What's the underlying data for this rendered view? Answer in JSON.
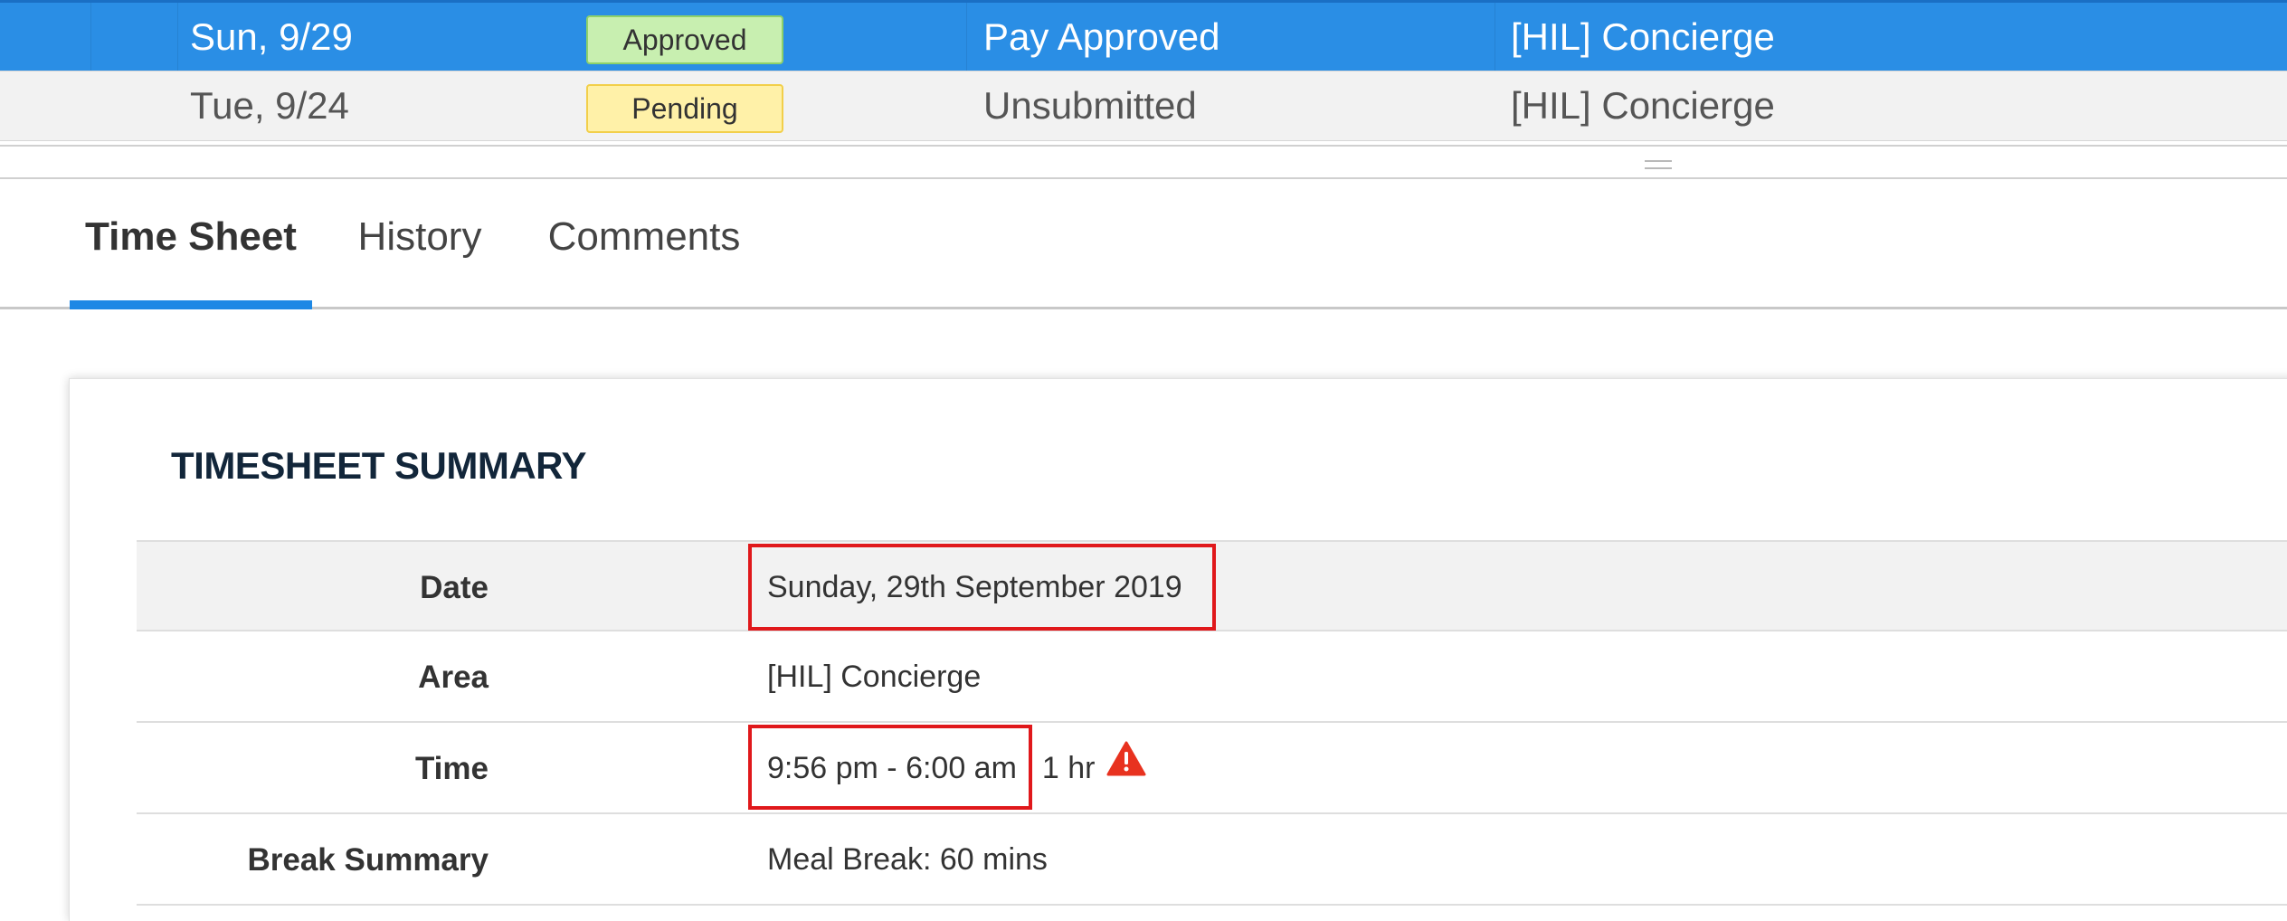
{
  "timesheets": [
    {
      "date": "Sun, 9/29",
      "status": "Approved",
      "pay_status": "Pay Approved",
      "area": "[HIL] Concierge",
      "selected": true
    },
    {
      "date": "Tue, 9/24",
      "status": "Pending",
      "pay_status": "Unsubmitted",
      "area": "[HIL] Concierge",
      "selected": false
    }
  ],
  "tabs": [
    {
      "label": "Time Sheet",
      "active": true
    },
    {
      "label": "History",
      "active": false
    },
    {
      "label": "Comments",
      "active": false
    }
  ],
  "summary": {
    "title": "TIMESHEET SUMMARY",
    "rows": {
      "date": {
        "label": "Date",
        "value": "Sunday, 29th September 2019"
      },
      "area": {
        "label": "Area",
        "value": "[HIL] Concierge"
      },
      "time": {
        "label": "Time",
        "value": "9:56 pm - 6:00 am",
        "hours": "1 hr",
        "icon": "warning-icon"
      },
      "break": {
        "label": "Break Summary",
        "value": "Meal Break: 60 mins"
      }
    }
  },
  "colors": {
    "selected_row": "#2a8ee5",
    "approved_badge": "#c8efb0",
    "pending_badge": "#fff1a8",
    "tab_indicator": "#1e88e5",
    "highlight_box": "#e0181b",
    "warning": "#e8321f"
  }
}
